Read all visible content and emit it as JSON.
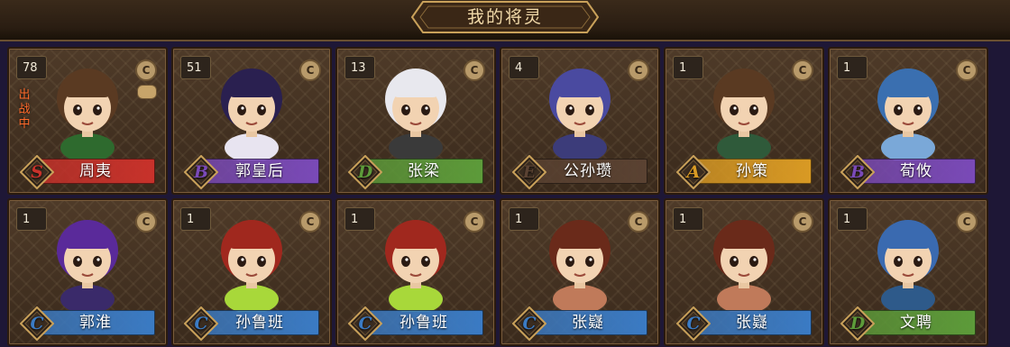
{
  "header": {
    "title": "我的将灵"
  },
  "rarity_colors": {
    "S": "#c8322b",
    "B": "#7a4ab8",
    "D": "#5d9b3a",
    "E": "#5a4232",
    "A": "#d99a24",
    "C": "#3b7bc4"
  },
  "cards": [
    {
      "level": "78",
      "name": "周夷",
      "grade": "S",
      "status": "出战中",
      "hair": "#5a3a22",
      "robe": "#2e6a2e",
      "icon": "general-portrait-icon"
    },
    {
      "level": "51",
      "name": "郭皇后",
      "grade": "B",
      "hair": "#2a2050",
      "robe": "#e8e4f0",
      "icon": "general-portrait-icon"
    },
    {
      "level": "13",
      "name": "张梁",
      "grade": "D",
      "hair": "#e8e8ee",
      "robe": "#3a3a3a",
      "icon": "general-portrait-icon"
    },
    {
      "level": "4",
      "name": "公孙瓒",
      "grade": "E",
      "hair": "#4a4aa0",
      "robe": "#3c3c7a",
      "icon": "general-portrait-icon"
    },
    {
      "level": "1",
      "name": "孙策",
      "grade": "A",
      "hair": "#5a3a22",
      "robe": "#2f5a3a",
      "icon": "general-portrait-icon"
    },
    {
      "level": "1",
      "name": "荀攸",
      "grade": "B",
      "hair": "#3a6fb0",
      "robe": "#7aa8d8",
      "icon": "general-portrait-icon"
    },
    {
      "level": "1",
      "name": "郭淮",
      "grade": "C",
      "hair": "#5a2a9a",
      "robe": "#3a2a6a",
      "icon": "general-portrait-icon"
    },
    {
      "level": "1",
      "name": "孙鲁班",
      "grade": "C",
      "hair": "#a0281e",
      "robe": "#a8d83a",
      "icon": "general-portrait-icon"
    },
    {
      "level": "1",
      "name": "孙鲁班",
      "grade": "C",
      "hair": "#a0281e",
      "robe": "#a8d83a",
      "icon": "general-portrait-icon"
    },
    {
      "level": "1",
      "name": "张嶷",
      "grade": "C",
      "hair": "#6a2a1a",
      "robe": "#c07a5a",
      "icon": "general-portrait-icon"
    },
    {
      "level": "1",
      "name": "张嶷",
      "grade": "C",
      "hair": "#6a2a1a",
      "robe": "#c07a5a",
      "icon": "general-portrait-icon"
    },
    {
      "level": "1",
      "name": "文聘",
      "grade": "D",
      "hair": "#3a6ab0",
      "robe": "#2e5a8a",
      "icon": "general-portrait-icon"
    }
  ]
}
